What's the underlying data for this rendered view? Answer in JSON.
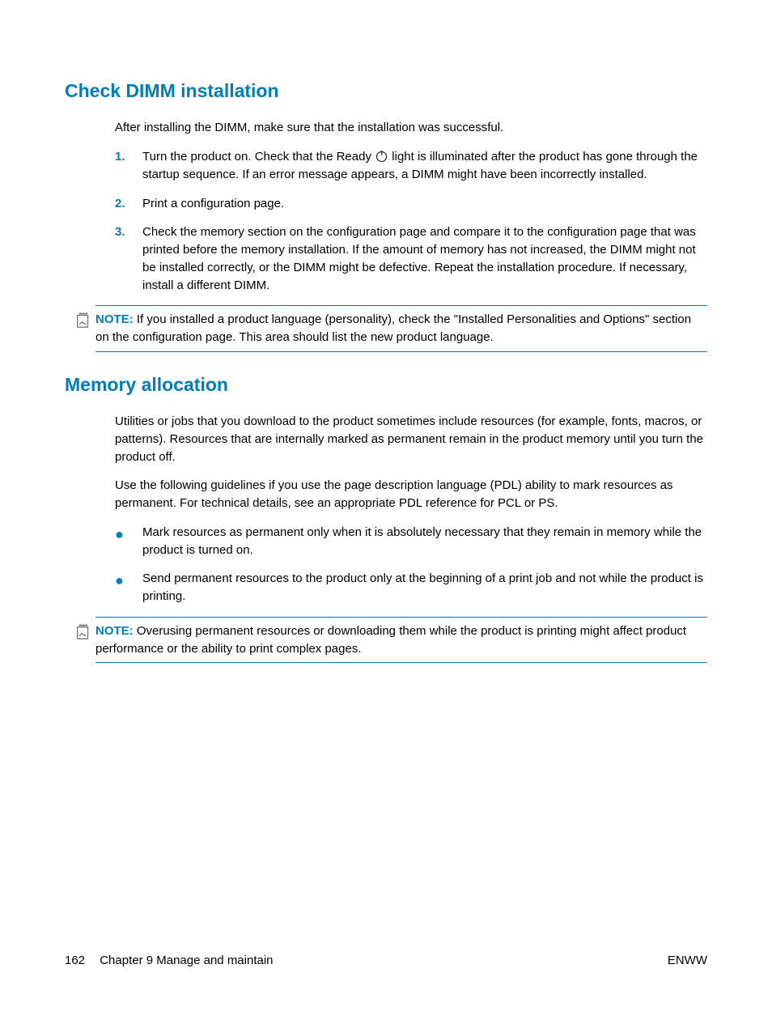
{
  "section1": {
    "heading": "Check DIMM installation",
    "intro": "After installing the DIMM, make sure that the installation was successful.",
    "step1_a": "Turn the product on. Check that the Ready ",
    "step1_b": " light is illuminated after the product has gone through the startup sequence. If an error message appears, a DIMM might have been incorrectly installed.",
    "step2": "Print a configuration page.",
    "step3": "Check the memory section on the configuration page and compare it to the configuration page that was printed before the memory installation. If the amount of memory has not increased, the DIMM might not be installed correctly, or the DIMM might be defective. Repeat the installation procedure. If necessary, install a different DIMM.",
    "note_label": "NOTE:",
    "note_text": "If you installed a product language (personality), check the \"Installed Personalities and Options\" section on the configuration page. This area should list the new product language."
  },
  "section2": {
    "heading": "Memory allocation",
    "p1": "Utilities or jobs that you download to the product sometimes include resources (for example, fonts, macros, or patterns). Resources that are internally marked as permanent remain in the product memory until you turn the product off.",
    "p2": "Use the following guidelines if you use the page description language (PDL) ability to mark resources as permanent. For technical details, see an appropriate PDL reference for PCL or PS.",
    "b1": "Mark resources as permanent only when it is absolutely necessary that they remain in memory while the product is turned on.",
    "b2": "Send permanent resources to the product only at the beginning of a print job and not while the product is printing.",
    "note_label": "NOTE:",
    "note_text": "Overusing permanent resources or downloading them while the product is printing might affect product performance or the ability to print complex pages."
  },
  "footer": {
    "page": "162",
    "chapter": "Chapter 9   Manage and maintain",
    "right": "ENWW"
  },
  "nums": {
    "n1": "1.",
    "n2": "2.",
    "n3": "3."
  }
}
